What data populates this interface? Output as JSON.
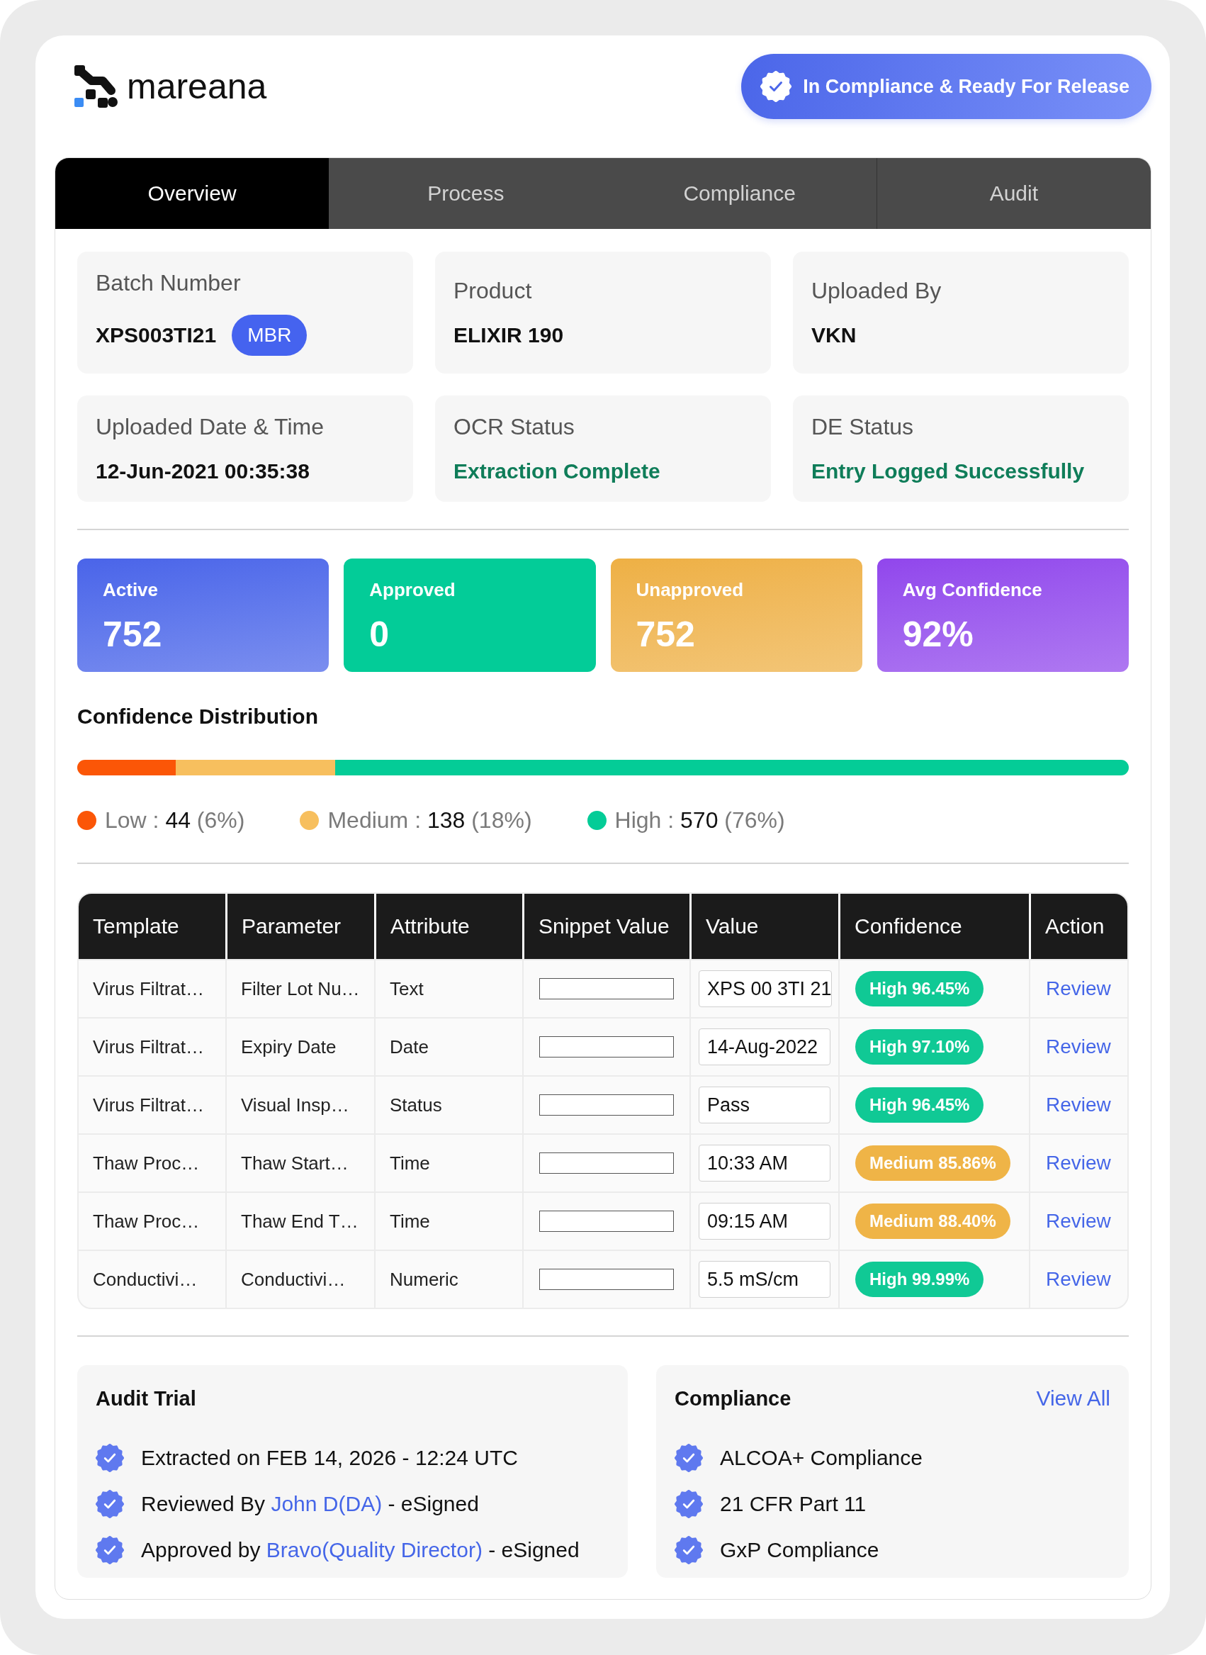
{
  "header": {
    "logo": "mareana",
    "status_badge": "In Compliance & Ready For Release"
  },
  "tabs": [
    {
      "label": "Overview",
      "selected": true
    },
    {
      "label": "Process",
      "selected": false
    },
    {
      "label": "Compliance",
      "selected": false
    },
    {
      "label": "Audit",
      "selected": false
    }
  ],
  "batch_info": [
    {
      "label": "Batch Number",
      "value": "XPS003TI21",
      "badge": "MBR",
      "kind": "text"
    },
    {
      "label": "Product",
      "value": "ELIXIR 190",
      "kind": "text"
    },
    {
      "label": "Uploaded By",
      "value": "VKN",
      "kind": "text"
    },
    {
      "label": "Uploaded Date & Time",
      "value": "12-Jun-2021 00:35:38",
      "kind": "text"
    },
    {
      "label": "OCR Status",
      "value": "Extraction Complete",
      "kind": "status"
    },
    {
      "label": "DE Status",
      "value": "Entry Logged Successfully",
      "kind": "status"
    }
  ],
  "stats": [
    {
      "label": "Active",
      "value": "752",
      "color": "#4a64e9",
      "kind": "gradient"
    },
    {
      "label": "Approved",
      "value": "0",
      "color": "#03cc98",
      "kind": "flat"
    },
    {
      "label": "Unapproved",
      "value": "752",
      "color": "#eeb044",
      "kind": "gradient"
    },
    {
      "label": "Avg Confidence",
      "value": "92%",
      "color": "#9146ec",
      "kind": "gradient"
    }
  ],
  "confidence_distribution": {
    "title": "Confidence Distribution",
    "segments": [
      {
        "label": "Low :",
        "count": "44",
        "percent": "(6%)",
        "color": "#fb5607",
        "level": 0.094
      },
      {
        "label": "Medium :",
        "count": "138",
        "percent": "(18%)",
        "color": "#f7bf5e",
        "level": 0.151
      },
      {
        "label": "High :",
        "count": "570",
        "percent": "(76%)",
        "color": "#04cc97",
        "level": 0.755
      }
    ]
  },
  "table": {
    "columns": [
      "Template",
      "Parameter",
      "Attribute",
      "Snippet Value",
      "Value",
      "Confidence",
      "Action"
    ],
    "rows": [
      {
        "template": "Virus Filtrat…",
        "parameter": "Filter Lot Nu…",
        "attribute": "Text",
        "value": "XPS 00 3TI 21",
        "confidence": {
          "text": "High 96.45%",
          "color": "#10c995"
        },
        "action": "Review"
      },
      {
        "template": "Virus Filtrat…",
        "parameter": "Expiry Date",
        "attribute": "Date",
        "value": "14-Aug-2022",
        "confidence": {
          "text": "High 97.10%",
          "color": "#10c995"
        },
        "action": "Review"
      },
      {
        "template": "Virus Filtrat…",
        "parameter": "Visual Insp…",
        "attribute": "Status",
        "value": "Pass",
        "confidence": {
          "text": "High 96.45%",
          "color": "#10c995"
        },
        "action": "Review"
      },
      {
        "template": "Thaw Proc…",
        "parameter": "Thaw Start…",
        "attribute": "Time",
        "value": "10:33 AM",
        "confidence": {
          "text": "Medium 85.86%",
          "color": "#efb447"
        },
        "action": "Review"
      },
      {
        "template": "Thaw Proc…",
        "parameter": "Thaw End T…",
        "attribute": "Time",
        "value": "09:15 AM",
        "confidence": {
          "text": "Medium 88.40%",
          "color": "#efb447"
        },
        "action": "Review"
      },
      {
        "template": "Conductivi…",
        "parameter": "Conductivi…",
        "attribute": "Numeric",
        "value": "5.5 mS/cm",
        "confidence": {
          "text": "High 99.99%",
          "color": "#10c995"
        },
        "action": "Review"
      }
    ]
  },
  "audit_trail": {
    "title": "Audit Trial",
    "entries": [
      {
        "text": "Extracted on FEB 14, 2026 - 12:24 UTC"
      },
      {
        "text": "Reviewed By",
        "link": "John D(DA)",
        "suffix": "- eSigned"
      },
      {
        "text": "Approved by",
        "link": "Bravo(Quality Director)",
        "suffix": "- eSigned"
      }
    ]
  },
  "compliance": {
    "title": "Compliance",
    "link": "View All",
    "items": [
      "ALCOA+ Compliance",
      "21 CFR Part 11",
      "GxP Compliance"
    ]
  }
}
